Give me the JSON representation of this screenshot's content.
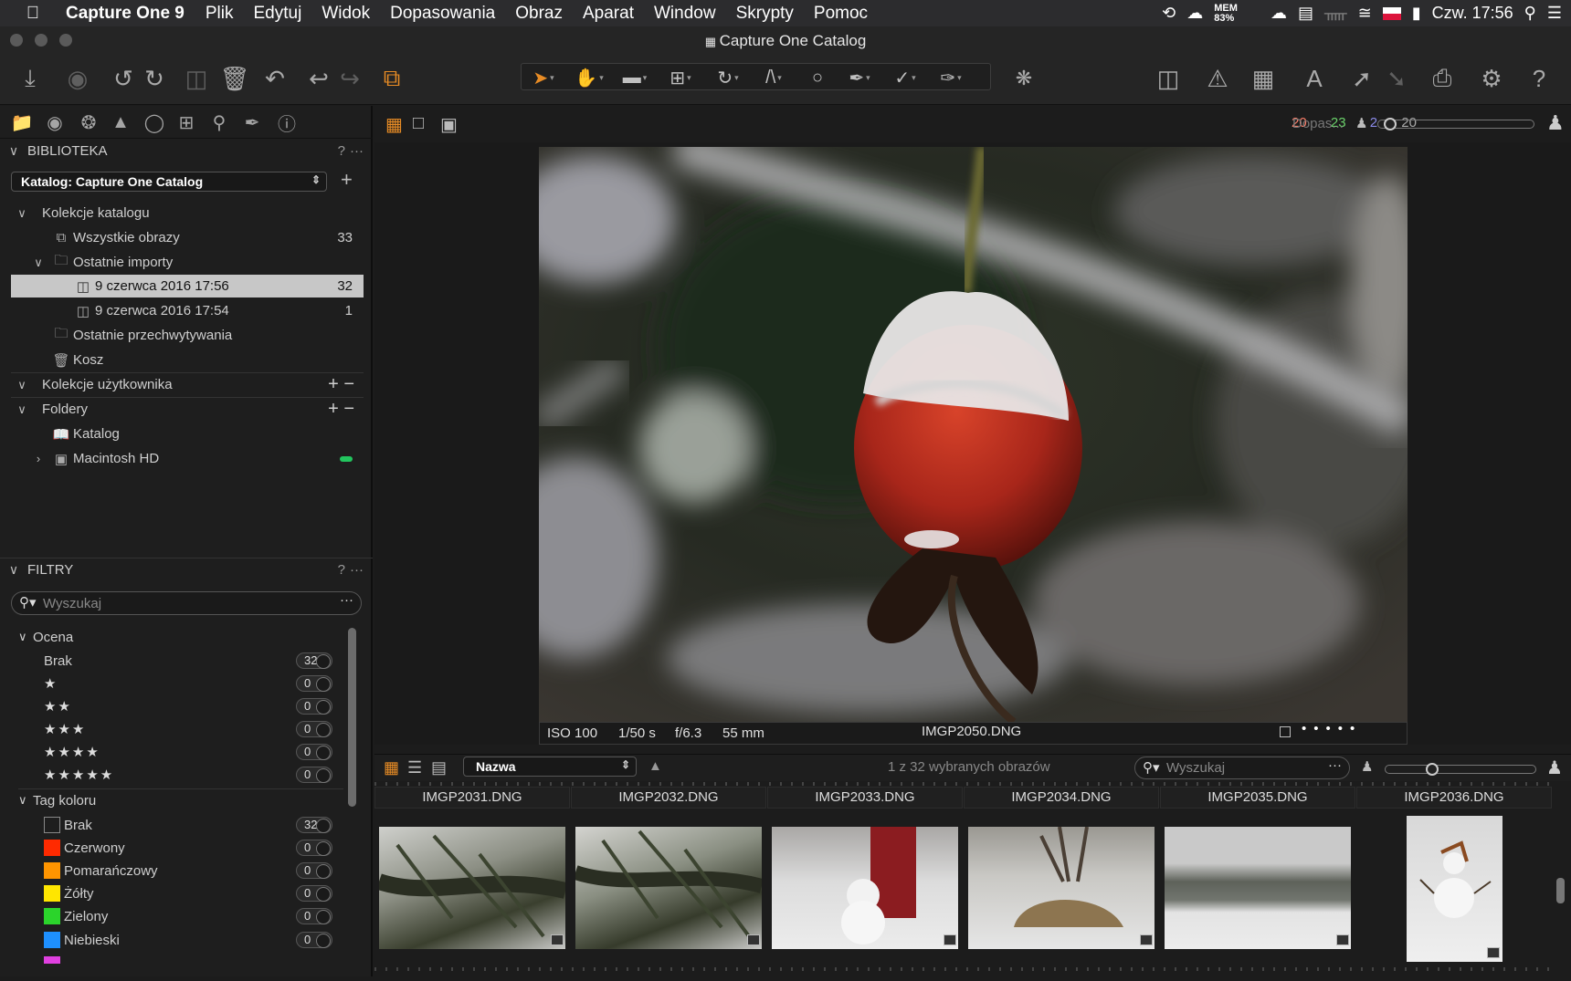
{
  "menubar": {
    "app_name": "Capture One 9",
    "items": [
      "Plik",
      "Edytuj",
      "Widok",
      "Dopasowania",
      "Obraz",
      "Aparat",
      "Window",
      "Skrypty",
      "Pomoc"
    ],
    "mem_label": "MEM",
    "mem_value": "83%",
    "clock": "Czw. 17:56"
  },
  "window": {
    "title": "Capture One Catalog"
  },
  "library": {
    "header": "BIBLIOTEKA",
    "help": "?",
    "more": "···",
    "catalog_select": "Katalog: Capture One Catalog",
    "items": [
      {
        "label": "Kolekcje katalogu",
        "count": ""
      },
      {
        "label": "Wszystkie obrazy",
        "count": "33"
      },
      {
        "label": "Ostatnie importy",
        "count": ""
      },
      {
        "label": "9 czerwca 2016 17:56",
        "count": "32"
      },
      {
        "label": "9 czerwca 2016 17:54",
        "count": "1"
      },
      {
        "label": "Ostatnie przechwytywania",
        "count": ""
      },
      {
        "label": "Kosz",
        "count": ""
      },
      {
        "label": "Kolekcje użytkownika",
        "count": ""
      },
      {
        "label": "Foldery",
        "count": ""
      },
      {
        "label": "Katalog",
        "count": ""
      },
      {
        "label": "Macintosh HD",
        "count": ""
      }
    ]
  },
  "filters": {
    "header": "FILTRY",
    "search_placeholder": "Wyszukaj",
    "rating_header": "Ocena",
    "ratings": [
      {
        "label": "Brak",
        "count": "32"
      },
      {
        "label": "★",
        "count": "0"
      },
      {
        "label": "★★",
        "count": "0"
      },
      {
        "label": "★★★",
        "count": "0"
      },
      {
        "label": "★★★★",
        "count": "0"
      },
      {
        "label": "★★★★★",
        "count": "0"
      }
    ],
    "color_header": "Tag koloru",
    "colors": [
      {
        "label": "Brak",
        "count": "32",
        "color": "transparent"
      },
      {
        "label": "Czerwony",
        "count": "0",
        "color": "#ff2a00"
      },
      {
        "label": "Pomarańczowy",
        "count": "0",
        "color": "#ff9500"
      },
      {
        "label": "Żółty",
        "count": "0",
        "color": "#ffe600"
      },
      {
        "label": "Zielony",
        "count": "0",
        "color": "#2bd42b"
      },
      {
        "label": "Niebieski",
        "count": "0",
        "color": "#1e90ff"
      }
    ]
  },
  "viewer": {
    "count_red": "20",
    "count_green": "23",
    "count_blue": "2",
    "count_gray": "20",
    "fit_label": "Dopas...",
    "iso": "ISO 100",
    "shutter": "1/50 s",
    "aperture": "f/6.3",
    "focal": "55 mm",
    "filename": "IMGP2050.DNG"
  },
  "browser": {
    "sort_select": "Nazwa",
    "selection_info": "1 z 32 wybranych obrazów",
    "search_placeholder": "Wyszukaj",
    "thumbnails": [
      "IMGP2031.DNG",
      "IMGP2032.DNG",
      "IMGP2033.DNG",
      "IMGP2034.DNG",
      "IMGP2035.DNG",
      "IMGP2036.DNG"
    ]
  },
  "colors": {
    "accent": "#e88c25",
    "selection": "#c7c7c7",
    "green_status": "#22c55e"
  }
}
